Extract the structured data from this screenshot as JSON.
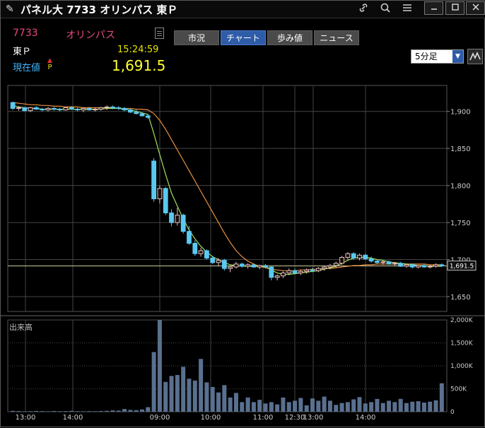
{
  "window": {
    "title": "パネル大 7733 オリンパス 東Ｐ",
    "title_icon": "pin-icon",
    "toolbar_icons": [
      "link-icon",
      "search-icon",
      "menu-icon"
    ],
    "buttons": [
      "minimize",
      "maximize",
      "close"
    ]
  },
  "stock": {
    "code": "7733",
    "name": "オリンパス",
    "market": "東Ｐ",
    "time": "15:24:59",
    "price_label": "現在値",
    "price_marker_arrow": "▲",
    "price_marker_letter": "P",
    "price": "1,691.5"
  },
  "tabs": [
    {
      "label": "市況",
      "active": false
    },
    {
      "label": "チャート",
      "active": true
    },
    {
      "label": "歩み値",
      "active": false
    },
    {
      "label": "ニュース",
      "active": false
    }
  ],
  "interval_select": {
    "value": "5分足"
  },
  "colors": {
    "up": "#e8c0c0",
    "down": "#5bc8f0",
    "ma_short": "#9fe05a",
    "ma_long": "#e89040",
    "current_line": "#cccc99",
    "volume": "#5a7090"
  },
  "chart_data": {
    "type": "candlestick",
    "price_axis": {
      "ticks": [
        "1,900",
        "1,850",
        "1,800",
        "1,750",
        "1,700",
        "1,650"
      ],
      "ylim": [
        1630,
        1935
      ]
    },
    "time_axis": {
      "ticks": [
        "13:00",
        "14:00",
        "09:00",
        "10:00",
        "11:00",
        "12:30",
        "13:00",
        "14:00"
      ]
    },
    "current_price_label": "1,691.5",
    "current_price": 1691.5,
    "volume_label": "出来高",
    "volume_axis": {
      "ticks": [
        "2,000K",
        "1,500K",
        "1,000K",
        "500K",
        "0"
      ],
      "ylim": [
        0,
        2000
      ]
    },
    "candles": [
      [
        1912,
        1913,
        1902,
        1904
      ],
      [
        1904,
        1907,
        1901,
        1905
      ],
      [
        1905,
        1906,
        1900,
        1901
      ],
      [
        1901,
        1906,
        1899,
        1905
      ],
      [
        1905,
        1907,
        1902,
        1903
      ],
      [
        1903,
        1905,
        1900,
        1902
      ],
      [
        1902,
        1906,
        1900,
        1904
      ],
      [
        1904,
        1906,
        1901,
        1903
      ],
      [
        1903,
        1905,
        1900,
        1902
      ],
      [
        1902,
        1906,
        1901,
        1905
      ],
      [
        1905,
        1907,
        1902,
        1903
      ],
      [
        1903,
        1905,
        1900,
        1902
      ],
      [
        1902,
        1905,
        1899,
        1904
      ],
      [
        1904,
        1906,
        1901,
        1902
      ],
      [
        1902,
        1905,
        1900,
        1903
      ],
      [
        1903,
        1906,
        1901,
        1905
      ],
      [
        1905,
        1908,
        1902,
        1906
      ],
      [
        1906,
        1908,
        1903,
        1905
      ],
      [
        1905,
        1907,
        1902,
        1904
      ],
      [
        1904,
        1906,
        1900,
        1902
      ],
      [
        1902,
        1904,
        1898,
        1899
      ],
      [
        1899,
        1902,
        1896,
        1897
      ],
      [
        1897,
        1899,
        1893,
        1894
      ],
      [
        1894,
        1896,
        1890,
        1892
      ],
      [
        1833,
        1837,
        1778,
        1782
      ],
      [
        1782,
        1800,
        1776,
        1796
      ],
      [
        1796,
        1798,
        1760,
        1763
      ],
      [
        1763,
        1768,
        1745,
        1750
      ],
      [
        1750,
        1770,
        1746,
        1760
      ],
      [
        1760,
        1762,
        1735,
        1738
      ],
      [
        1738,
        1745,
        1720,
        1722
      ],
      [
        1722,
        1726,
        1705,
        1708
      ],
      [
        1708,
        1716,
        1704,
        1712
      ],
      [
        1712,
        1714,
        1700,
        1702
      ],
      [
        1702,
        1705,
        1694,
        1696
      ],
      [
        1696,
        1702,
        1692,
        1699
      ],
      [
        1699,
        1701,
        1685,
        1688
      ],
      [
        1688,
        1692,
        1683,
        1690
      ],
      [
        1690,
        1697,
        1688,
        1694
      ],
      [
        1694,
        1696,
        1689,
        1691
      ],
      [
        1691,
        1695,
        1688,
        1693
      ],
      [
        1693,
        1695,
        1689,
        1690
      ],
      [
        1690,
        1693,
        1687,
        1692
      ],
      [
        1692,
        1694,
        1688,
        1690
      ],
      [
        1690,
        1692,
        1672,
        1676
      ],
      [
        1676,
        1680,
        1672,
        1678
      ],
      [
        1678,
        1684,
        1675,
        1682
      ],
      [
        1682,
        1688,
        1679,
        1685
      ],
      [
        1685,
        1688,
        1680,
        1682
      ],
      [
        1682,
        1686,
        1679,
        1684
      ],
      [
        1684,
        1688,
        1681,
        1686
      ],
      [
        1686,
        1689,
        1683,
        1685
      ],
      [
        1685,
        1690,
        1683,
        1688
      ],
      [
        1688,
        1692,
        1685,
        1690
      ],
      [
        1690,
        1694,
        1687,
        1692
      ],
      [
        1692,
        1697,
        1689,
        1695
      ],
      [
        1695,
        1705,
        1693,
        1703
      ],
      [
        1703,
        1710,
        1700,
        1708
      ],
      [
        1708,
        1710,
        1700,
        1702
      ],
      [
        1702,
        1708,
        1699,
        1706
      ],
      [
        1706,
        1708,
        1700,
        1701
      ],
      [
        1701,
        1704,
        1696,
        1698
      ],
      [
        1698,
        1700,
        1694,
        1696
      ],
      [
        1696,
        1699,
        1693,
        1697
      ],
      [
        1697,
        1699,
        1693,
        1694
      ],
      [
        1694,
        1697,
        1691,
        1695
      ],
      [
        1695,
        1697,
        1690,
        1691
      ],
      [
        1691,
        1694,
        1689,
        1693
      ],
      [
        1693,
        1695,
        1688,
        1690
      ],
      [
        1690,
        1693,
        1688,
        1692
      ],
      [
        1692,
        1694,
        1689,
        1690
      ],
      [
        1690,
        1693,
        1688,
        1691
      ],
      [
        1691,
        1695,
        1689,
        1693
      ],
      [
        1693,
        1695,
        1690,
        1691.5
      ]
    ],
    "ma_short": [
      1908,
      1906,
      1905,
      1904,
      1904,
      1903,
      1903,
      1903,
      1903,
      1903,
      1903,
      1903,
      1903,
      1903,
      1903,
      1903,
      1904,
      1904,
      1904,
      1903,
      1902,
      1900,
      1898,
      1896,
      1870,
      1842,
      1815,
      1790,
      1772,
      1755,
      1740,
      1728,
      1718,
      1710,
      1704,
      1700,
      1696,
      1693,
      1692,
      1691,
      1691,
      1691,
      1691,
      1691,
      1686,
      1682,
      1680,
      1680,
      1681,
      1682,
      1683,
      1684,
      1685,
      1687,
      1689,
      1691,
      1695,
      1699,
      1702,
      1703,
      1703,
      1702,
      1700,
      1699,
      1697,
      1696,
      1695,
      1694,
      1693,
      1692,
      1692,
      1691,
      1691,
      1691
    ],
    "ma_long": [
      1912,
      1911,
      1910,
      1909,
      1909,
      1908,
      1908,
      1907,
      1907,
      1906,
      1906,
      1906,
      1905,
      1905,
      1905,
      1905,
      1905,
      1905,
      1904,
      1904,
      1904,
      1903,
      1903,
      1902,
      1897,
      1888,
      1876,
      1862,
      1848,
      1834,
      1820,
      1806,
      1792,
      1778,
      1764,
      1750,
      1736,
      1723,
      1712,
      1704,
      1698,
      1694,
      1691,
      1689,
      1687,
      1686,
      1685,
      1685,
      1685,
      1686,
      1686,
      1687,
      1687,
      1688,
      1688,
      1689,
      1690,
      1691,
      1692,
      1692,
      1693,
      1693,
      1694,
      1694,
      1694,
      1694,
      1694,
      1694,
      1694,
      1694,
      1694,
      1693,
      1693,
      1693
    ],
    "volume": [
      20,
      15,
      10,
      12,
      18,
      14,
      10,
      16,
      12,
      14,
      20,
      12,
      10,
      14,
      12,
      16,
      20,
      30,
      26,
      60,
      40,
      35,
      50,
      100,
      1300,
      2000,
      650,
      780,
      800,
      980,
      720,
      680,
      1150,
      640,
      540,
      420,
      580,
      310,
      410,
      210,
      310,
      210,
      260,
      180,
      210,
      160,
      310,
      210,
      240,
      300,
      140,
      290,
      240,
      330,
      240,
      150,
      190,
      210,
      270,
      320,
      180,
      210,
      280,
      190,
      240,
      210,
      280,
      190,
      220,
      230,
      200,
      220,
      250,
      620
    ]
  }
}
